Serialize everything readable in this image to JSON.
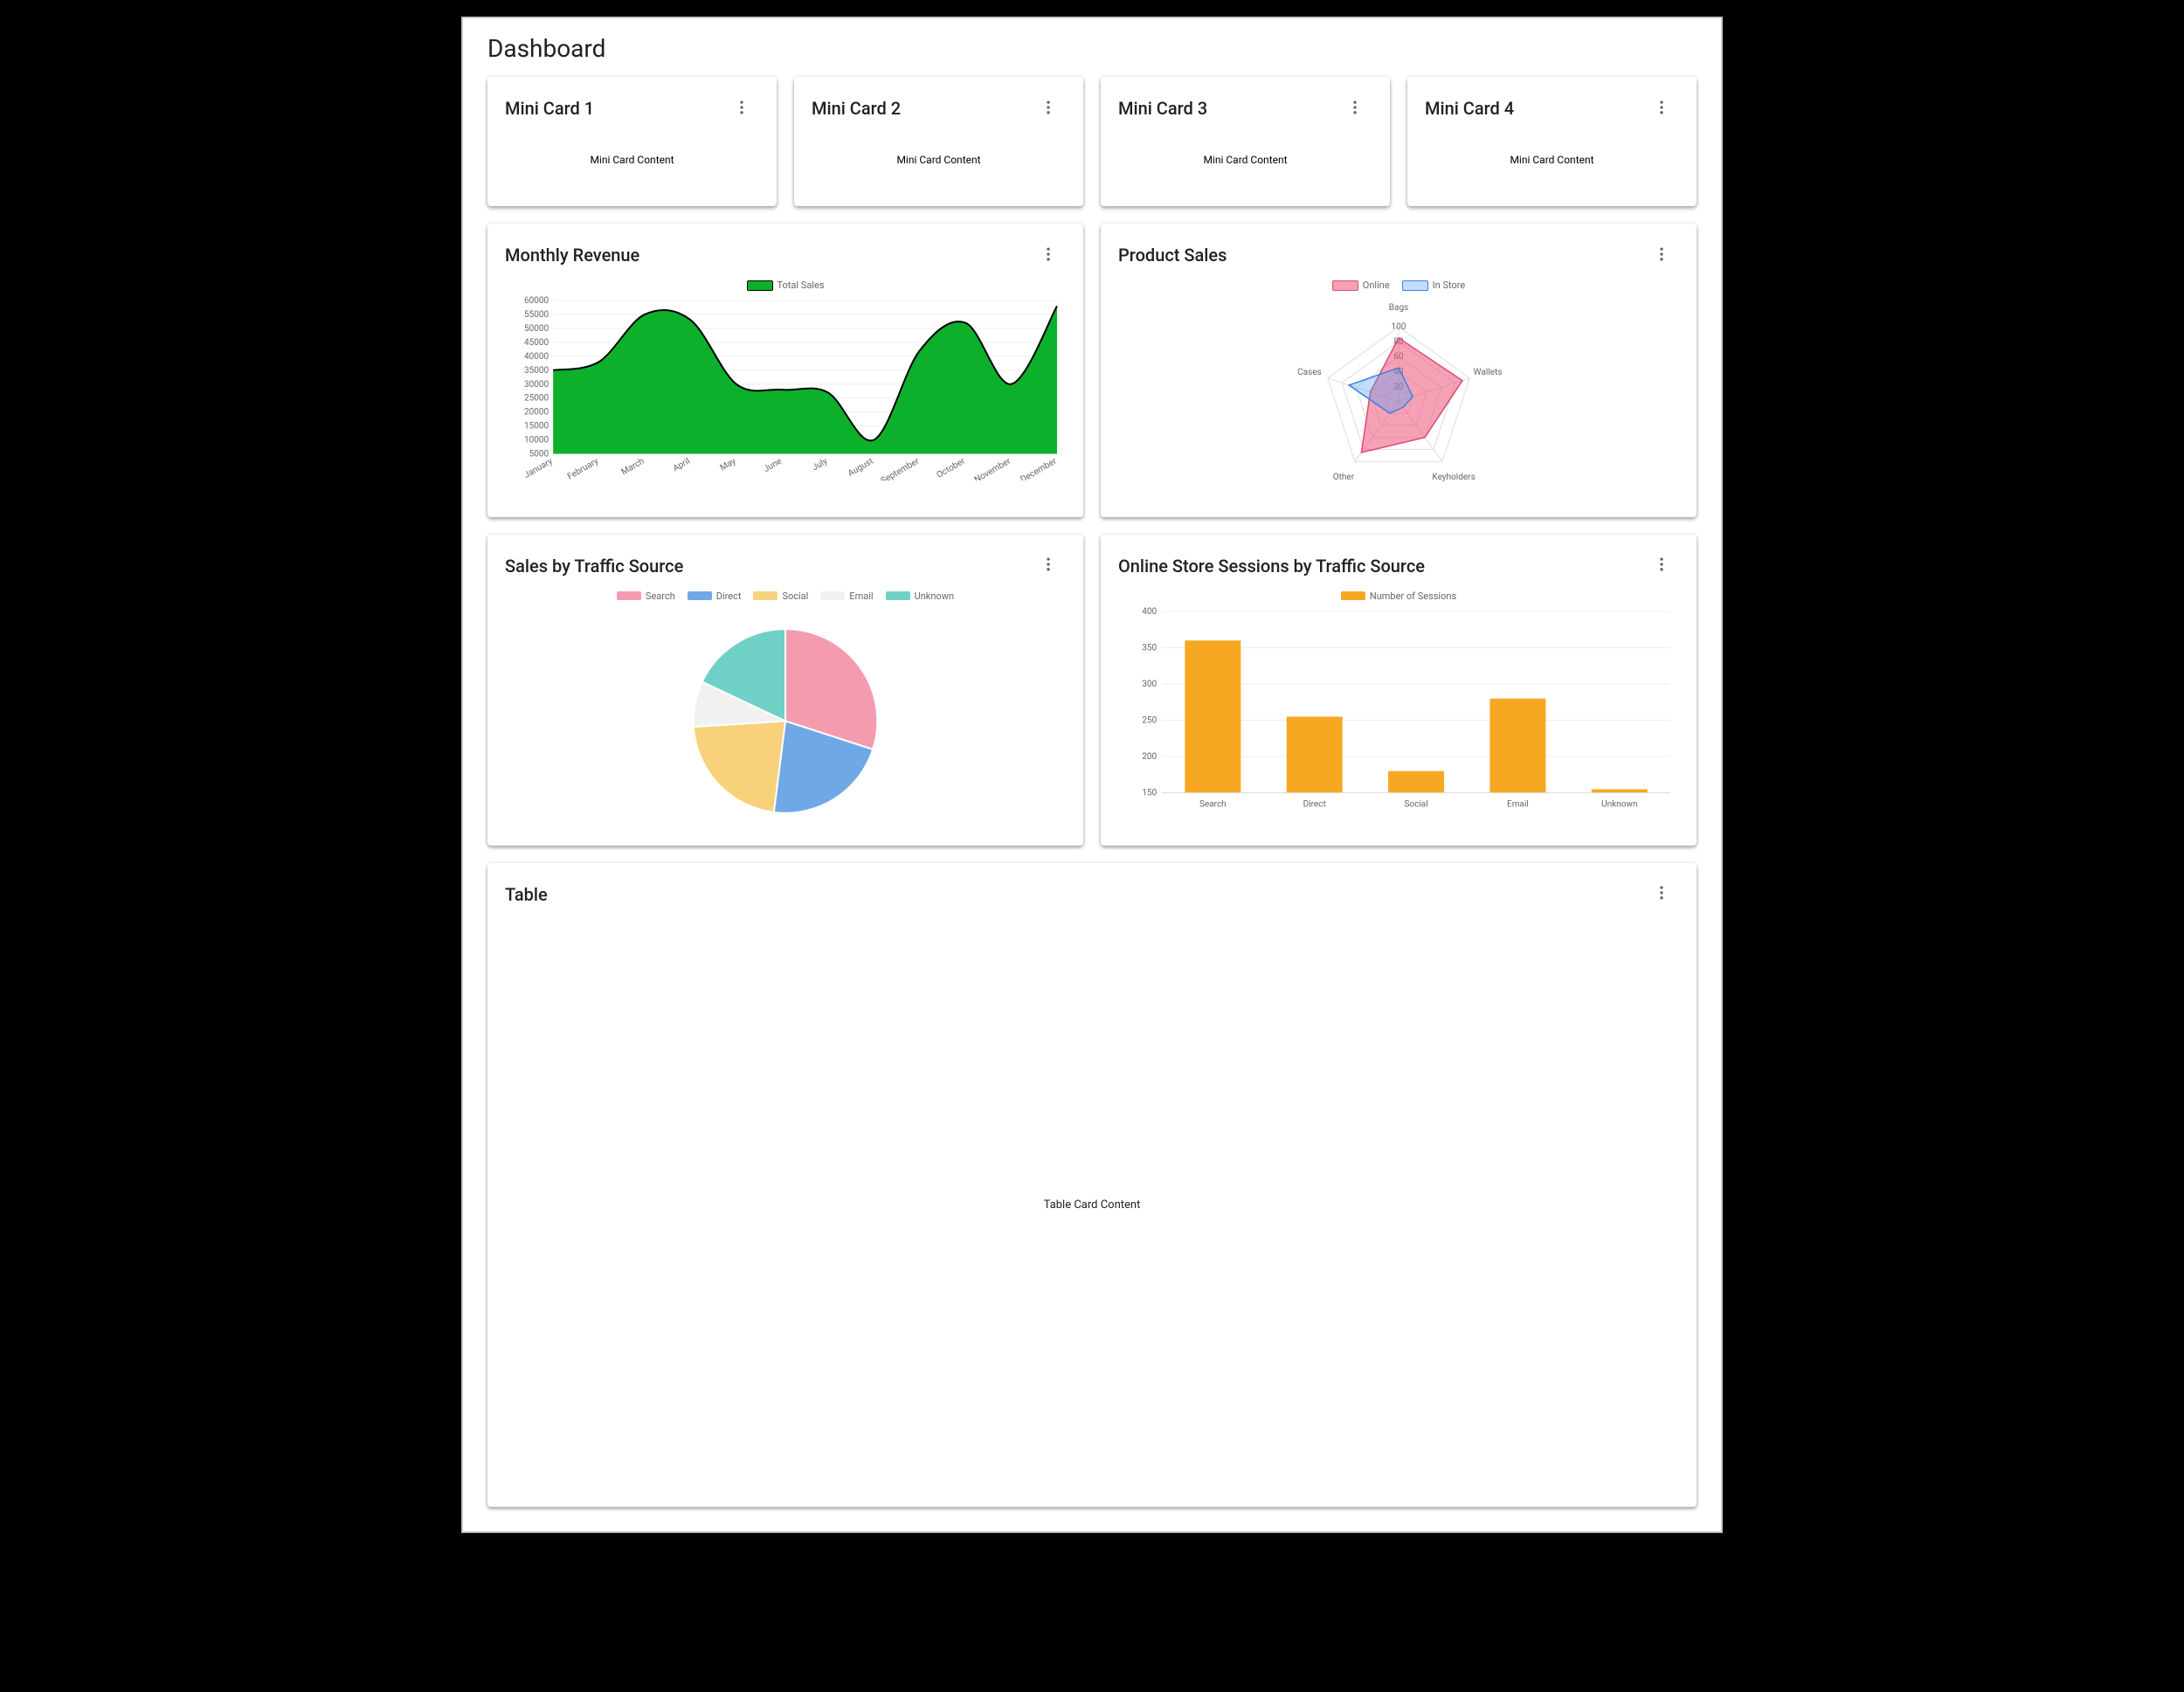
{
  "page": {
    "title": "Dashboard"
  },
  "miniCards": [
    {
      "title": "Mini Card 1",
      "content": "Mini Card Content"
    },
    {
      "title": "Mini Card 2",
      "content": "Mini Card Content"
    },
    {
      "title": "Mini Card 3",
      "content": "Mini Card Content"
    },
    {
      "title": "Mini Card 4",
      "content": "Mini Card Content"
    }
  ],
  "colors": {
    "area_fill": "#0db02b",
    "area_stroke": "#000000",
    "radar_online_fill": "rgba(239,83,121,.55)",
    "radar_online_stroke": "#de4b73",
    "radar_instore_fill": "rgba(77,160,255,.35)",
    "radar_instore_stroke": "#3f7fe0",
    "bar": "#f7a823",
    "pie": [
      "#f59bb0",
      "#6fa8e6",
      "#f8d27a",
      "#f1f1f1",
      "#6fd0c6"
    ]
  },
  "chart_data": [
    {
      "id": "monthly-revenue",
      "title": "Monthly Revenue",
      "type": "area",
      "legend": [
        "Total Sales"
      ],
      "x": [
        "January",
        "February",
        "March",
        "April",
        "May",
        "June",
        "July",
        "August",
        "September",
        "October",
        "November",
        "December"
      ],
      "series": [
        {
          "name": "Total Sales",
          "values": [
            35000,
            38000,
            55000,
            53000,
            30000,
            28000,
            27000,
            10000,
            42000,
            52000,
            30000,
            58000
          ]
        }
      ],
      "ylabel": "",
      "ylim": [
        5000,
        60000
      ],
      "yticks": [
        5000,
        10000,
        15000,
        20000,
        25000,
        30000,
        35000,
        40000,
        45000,
        50000,
        55000,
        60000
      ],
      "grid": true
    },
    {
      "id": "product-sales",
      "title": "Product Sales",
      "type": "radar",
      "categories": [
        "Bags",
        "Wallets",
        "Keyholders",
        "Other",
        "Cases"
      ],
      "rings": [
        20,
        40,
        60,
        80,
        100
      ],
      "series": [
        {
          "name": "Online",
          "values": [
            85,
            90,
            60,
            85,
            40
          ]
        },
        {
          "name": "In Store",
          "values": [
            45,
            20,
            10,
            20,
            70
          ]
        }
      ]
    },
    {
      "id": "sales-by-source",
      "title": "Sales by Traffic Source",
      "type": "pie",
      "categories": [
        "Search",
        "Direct",
        "Social",
        "Email",
        "Unknown"
      ],
      "values": [
        30,
        22,
        22,
        8,
        18
      ]
    },
    {
      "id": "sessions-by-source",
      "title": "Online Store Sessions by Traffic Source",
      "type": "bar",
      "legend": [
        "Number of Sessions"
      ],
      "categories": [
        "Search",
        "Direct",
        "Social",
        "Email",
        "Unknown"
      ],
      "values": [
        360,
        255,
        180,
        280,
        155
      ],
      "ylim": [
        150,
        400
      ],
      "yticks": [
        150,
        200,
        250,
        300,
        350,
        400
      ]
    }
  ],
  "tableCard": {
    "title": "Table",
    "content": "Table Card Content"
  }
}
